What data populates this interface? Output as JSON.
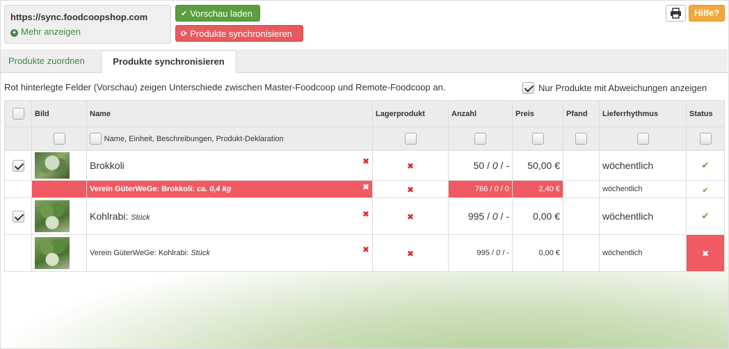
{
  "header": {
    "url": "https://sync.foodcoopshop.com",
    "more_label": "Mehr anzeigen",
    "preview_button": "Vorschau laden",
    "sync_button": "Produkte synchronisieren",
    "print_icon": "printer-icon",
    "help_button": "Hilfe?"
  },
  "tabs": {
    "assign": "Produkte zuordnen",
    "sync": "Produkte synchronisieren"
  },
  "info_text": "Rot hinterlegte Felder (Vorschau) zeigen Unterschiede zwischen Master-Foodcoop und Remote-Foodcoop an.",
  "filter_label": "Nur Produkte mit Abweichungen anzeigen",
  "table": {
    "columns": {
      "image": "Bild",
      "name": "Name",
      "stock": "Lagerprodukt",
      "amount": "Anzahl",
      "price": "Preis",
      "deposit": "Pfand",
      "rhythm": "Lieferrhythmus",
      "status": "Status"
    },
    "name_filter_label": "Name, Einheit, Beschreibungen, Produkt-Deklaration",
    "rows": [
      {
        "name": "Brokkoli",
        "unit": "",
        "amount": "50 / 0 / -",
        "amount_a": "50 / ",
        "amount_b": "0",
        "amount_c": " / -",
        "price": "50,00 €",
        "rhythm": "wöchentlich"
      },
      {
        "name": "Verein GüterWeGe: Brokkoli:",
        "unit": "ca. 0,4 kg",
        "amount_a": "766 / ",
        "amount_b": "0",
        "amount_c": " / 0",
        "price": "2,40 €",
        "rhythm": "wöchentlich"
      },
      {
        "name": "Kohlrabi:",
        "unit": "Stück",
        "amount_a": "995 / ",
        "amount_b": "0",
        "amount_c": " / -",
        "price": "0,00 €",
        "rhythm": "wöchentlich"
      },
      {
        "name": "Verein GüterWeGe: Kohlrabi:",
        "unit": "Stück",
        "amount_a": "995 / ",
        "amount_b": "0",
        "amount_c": " / -",
        "price": "0,00 €",
        "rhythm": "wöchentlich"
      }
    ]
  },
  "colors": {
    "green": "#5a9e3e",
    "red": "#f05a62",
    "orange": "#f0a93c"
  }
}
